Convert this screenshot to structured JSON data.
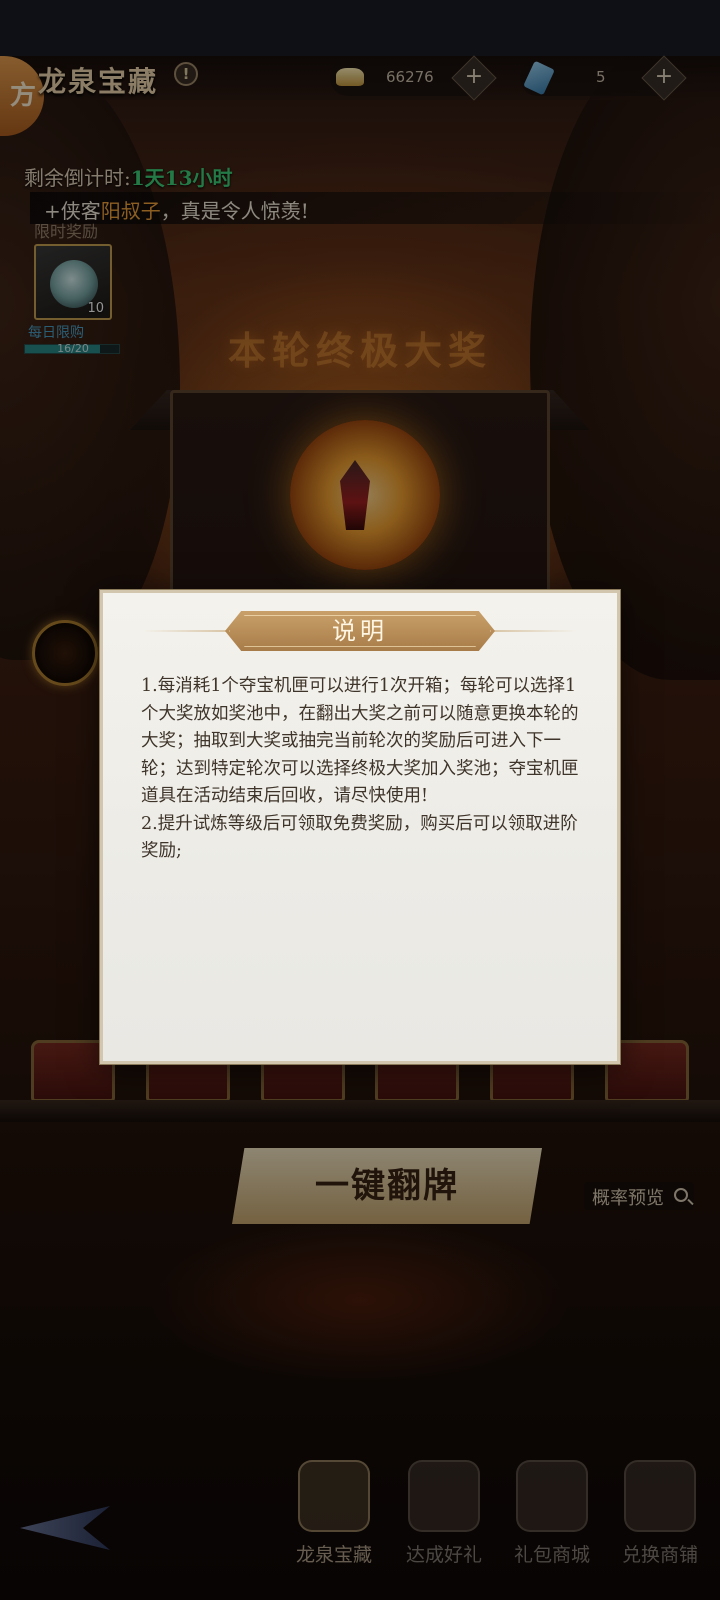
{
  "header": {
    "back_badge": "方",
    "title": "龙泉宝藏",
    "info_label": "!",
    "currency_gold": {
      "icon": "gold-ingot-icon",
      "value": "66276",
      "plus": "+"
    },
    "currency_ticket": {
      "icon": "treasure-ticket-icon",
      "value": "5",
      "plus": "+"
    }
  },
  "countdown": {
    "label": "剩余倒计时:",
    "value": "1天13小时"
  },
  "marquee": {
    "prefix": "+侠客",
    "highlight": "阳叔子",
    "suffix": "，真是令人惊羡!"
  },
  "limited_reward": {
    "label": "限时奖励",
    "count": "10",
    "subtitle": "每日限购",
    "progress_text": "16/20",
    "progress": 0.8
  },
  "scene": {
    "grand_prize_title": "本轮终极大奖"
  },
  "actions": {
    "flip_all": "一键翻牌",
    "probability_preview": "概率预览"
  },
  "bottom_nav": [
    {
      "label": "龙泉宝藏",
      "icon": "treasure-scroll-icon",
      "active": true
    },
    {
      "label": "达成好礼",
      "icon": "achievement-disc-icon",
      "active": false
    },
    {
      "label": "礼包商城",
      "icon": "gift-shop-icon",
      "active": false
    },
    {
      "label": "兑换商铺",
      "icon": "exchange-shop-icon",
      "active": false
    }
  ],
  "modal": {
    "title": "说明",
    "paragraphs": [
      "1.每消耗1个夺宝机匣可以进行1次开箱；每轮可以选择1个大奖放如奖池中，在翻出大奖之前可以随意更换本轮的大奖；抽取到大奖或抽完当前轮次的奖励后可进入下一轮；达到特定轮次可以选择终极大奖加入奖池；夺宝机匣道具在活动结束后回收，请尽快使用!",
      "2.提升试炼等级后可领取免费奖励，购买后可以领取进阶奖励;"
    ]
  },
  "colors": {
    "countdown_value": "#3ed27a",
    "marquee_highlight": "#f2a23a",
    "modal_bg": "#f0efea",
    "header_plate": "#b88c56"
  }
}
